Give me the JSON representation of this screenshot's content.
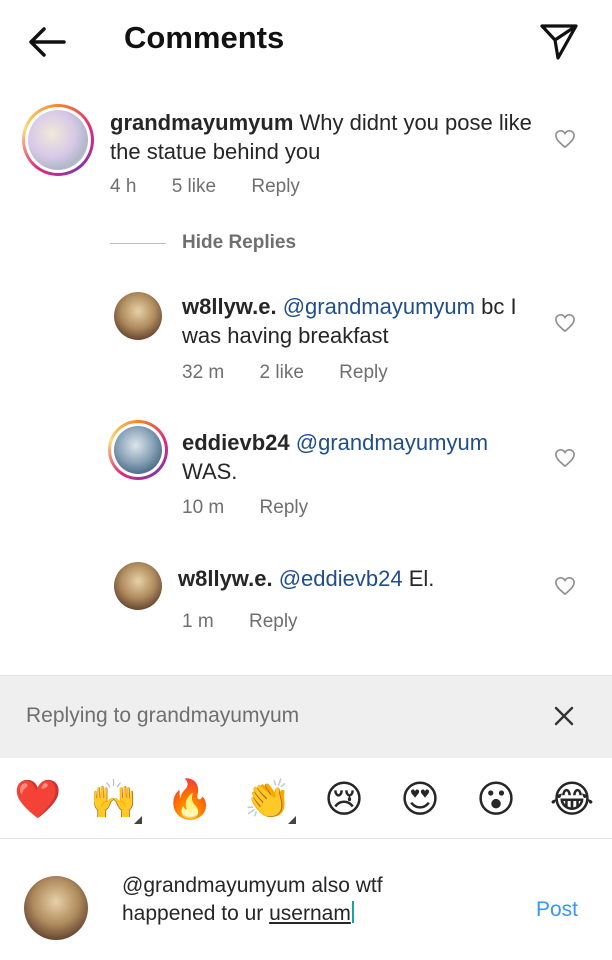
{
  "header": {
    "title": "Comments",
    "back_icon": "arrow-left-icon",
    "share_icon": "paper-plane-icon"
  },
  "comments": [
    {
      "user": "grandmayumyum",
      "text": "Why didnt you pose like the statue behind you",
      "time": "4 h",
      "likes": "5 like",
      "reply": "Reply"
    }
  ],
  "hide_replies": "Hide Replies",
  "replies": [
    {
      "user": "w8llyw.e.",
      "mention": "@grandmayumyum",
      "text": "bc I was having breakfast",
      "time": "32 m",
      "likes": "2 like",
      "reply": "Reply"
    },
    {
      "user": "eddievb24",
      "mention": "@grandmayumyum",
      "text": "WAS.",
      "time": "10 m",
      "reply": "Reply"
    },
    {
      "user": "w8llyw.e.",
      "mention": "@eddievb24",
      "text": "El.",
      "time": "1 m",
      "reply": "Reply"
    }
  ],
  "reply_bar": {
    "label": "Replying to grandmayumyum"
  },
  "emojis": [
    "❤️",
    "🙌",
    "🔥",
    "👏",
    "😢",
    "😍",
    "😮",
    "😂"
  ],
  "composer": {
    "text_line1": "@grandmayumyum also wtf",
    "text_line2_plain": "happened to ur ",
    "text_line2_underlined": "usernam",
    "post_label": "Post"
  },
  "colors": {
    "mention": "#1f4e8a",
    "post": "#3897f0",
    "heart_emoji": "#e0245e"
  }
}
